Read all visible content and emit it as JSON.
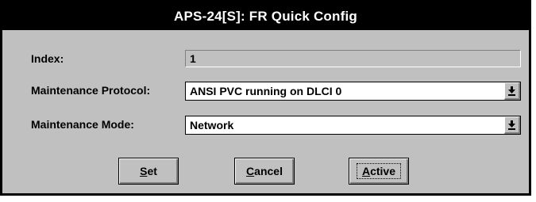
{
  "window": {
    "title": "APS-24[S]: FR Quick Config"
  },
  "form": {
    "index": {
      "label": "Index:",
      "value": "1"
    },
    "protocol": {
      "label": "Maintenance Protocol:",
      "value": "ANSI PVC running on DLCI 0"
    },
    "mode": {
      "label": "Maintenance Mode:",
      "value": "Network"
    }
  },
  "buttons": {
    "set": {
      "mnemonic": "S",
      "rest": "et"
    },
    "cancel": {
      "mnemonic": "C",
      "rest": "ancel"
    },
    "active": {
      "mnemonic": "A",
      "rest": "ctive"
    }
  }
}
